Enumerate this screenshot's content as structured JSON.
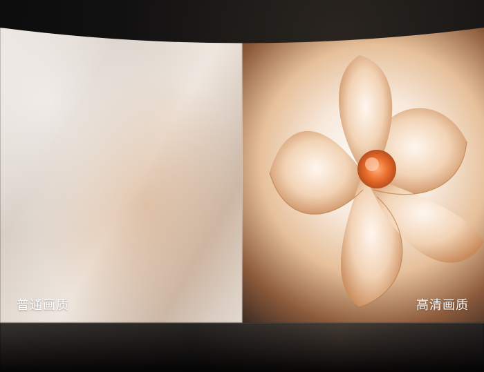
{
  "labels": {
    "left": "普通画质",
    "right": "高清画质"
  },
  "colors": {
    "background": "#0b0b0c",
    "label_text": "#ffffff",
    "accent_center": "#e86b2a"
  }
}
